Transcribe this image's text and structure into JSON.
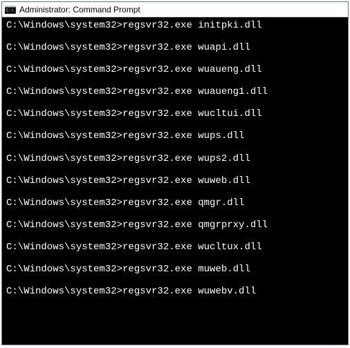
{
  "window": {
    "title": "Administrator: Command Prompt"
  },
  "terminal": {
    "prompt": "C:\\Windows\\system32>",
    "lines": [
      "C:\\Windows\\system32>regsvr32.exe initpki.dll",
      "",
      "C:\\Windows\\system32>regsvr32.exe wuapi.dll",
      "",
      "C:\\Windows\\system32>regsvr32.exe wuaueng.dll",
      "",
      "C:\\Windows\\system32>regsvr32.exe wuaueng1.dll",
      "",
      "C:\\Windows\\system32>regsvr32.exe wucltui.dll",
      "",
      "C:\\Windows\\system32>regsvr32.exe wups.dll",
      "",
      "C:\\Windows\\system32>regsvr32.exe wups2.dll",
      "",
      "C:\\Windows\\system32>regsvr32.exe wuweb.dll",
      "",
      "C:\\Windows\\system32>regsvr32.exe qmgr.dll",
      "",
      "C:\\Windows\\system32>regsvr32.exe qmgrprxy.dll",
      "",
      "C:\\Windows\\system32>regsvr32.exe wucltux.dll",
      "",
      "C:\\Windows\\system32>regsvr32.exe muweb.dll",
      "",
      "C:\\Windows\\system32>regsvr32.exe wuwebv.dll"
    ]
  }
}
